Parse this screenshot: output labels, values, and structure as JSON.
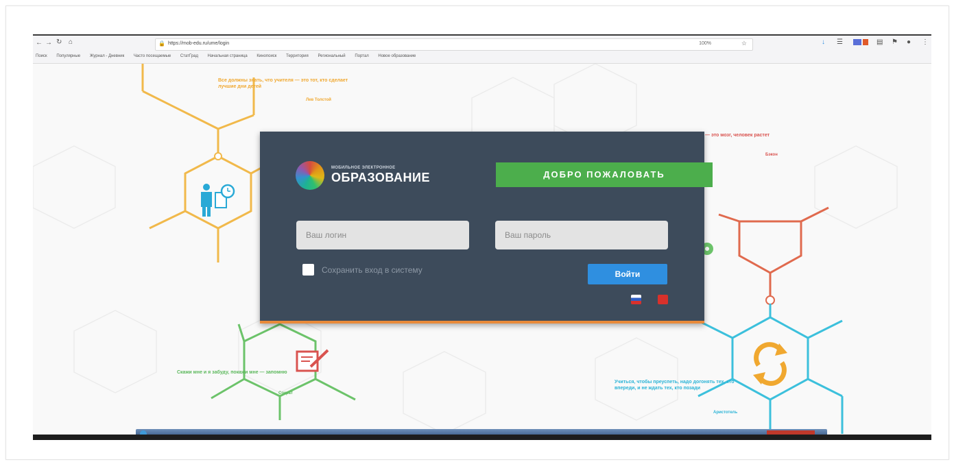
{
  "browser": {
    "url": "https://mob-edu.ru/ume/login",
    "zoom": "100%",
    "bookmarks": [
      "Поиск",
      "Популярные",
      "Журнал - Дневник",
      "Часто посещаемые",
      "СтатГрад",
      "Начальная страница",
      "Кинопоиск",
      "Территория",
      "Региональный",
      "Портал",
      "Новое образование"
    ]
  },
  "quotes": {
    "top_left": "Все должны знать, что учителя — это тот, кто сделает лучшие дни детей",
    "top_left_author": "Лев Толстой",
    "top_right": "— это мозг, человек растет",
    "top_right_author": "Бэкон",
    "bottom_left": "Скажи мне и я забуду, покажи мне — запомню",
    "bottom_left_author": "Сократ",
    "bottom_right": "Учиться, чтобы преуспеть, надо догонять тех, кто впереди, и не ждать тех, кто позади",
    "bottom_right_author": "Аристотель"
  },
  "login": {
    "logo_small": "МОБИЛЬНОЕ ЭЛЕКТРОННОЕ",
    "logo_big": "ОБРАЗОВАНИЕ",
    "welcome": "ДОБРО ПОЖАЛОВАТЬ",
    "login_placeholder": "Ваш логин",
    "password_placeholder": "Ваш пароль",
    "remember_label": "Сохранить вход в систему",
    "submit": "Войти"
  },
  "colors": {
    "panel": "#3d4b5b",
    "welcome": "#4cae4c",
    "submit": "#2f8fe0",
    "orange": "#e8a83a",
    "red": "#d9534f",
    "green": "#5cb85c",
    "cyan": "#2ab3d6"
  }
}
